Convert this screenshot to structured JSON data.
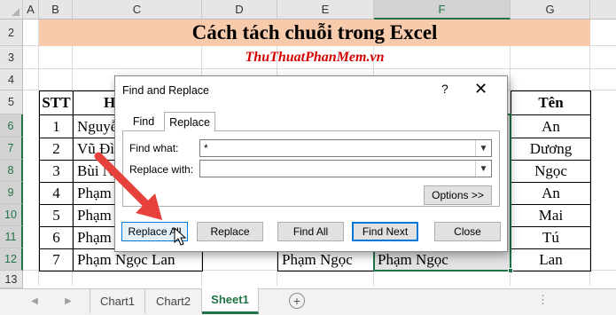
{
  "columns": [
    "A",
    "B",
    "C",
    "D",
    "E",
    "F",
    "G"
  ],
  "selected_column": "F",
  "rows": [
    "1",
    "2",
    "3",
    "4",
    "5",
    "6",
    "7",
    "8",
    "9",
    "10",
    "11",
    "12",
    "13"
  ],
  "sheet": {
    "title": "Cách tách chuỗi trong Excel",
    "subtitle": "ThuThuatPhanMem.vn",
    "table_headers": {
      "stt": "STT",
      "ho_partial": "H",
      "ten": "Tên"
    },
    "stt": [
      "1",
      "2",
      "3",
      "4",
      "5",
      "6",
      "7"
    ],
    "names_partial": [
      "Nguyễ",
      "Vũ Đì",
      "Bùi N",
      "Phạm",
      "Phạm",
      "Phạm",
      "Phạm Ngọc Lan"
    ],
    "ten": [
      "An",
      "Dương",
      "Ngọc",
      "An",
      "Mai",
      "Tú",
      "Lan"
    ],
    "row12_e": "Phạm Ngọc",
    "row12_f": "Phạm Ngọc"
  },
  "tabs": {
    "prev_arrow": "◀",
    "next_arrow": "▶",
    "items": [
      "Chart1",
      "Chart2",
      "Sheet1"
    ],
    "active": "Sheet1",
    "add_symbol": "+",
    "more": "⋮"
  },
  "dialog": {
    "title": "Find and Replace",
    "help": "?",
    "close": "✕",
    "tabs": [
      "Find",
      "Replace"
    ],
    "active_tab": "Replace",
    "find_what_label": "Find what:",
    "find_what_value": "*",
    "replace_with_label": "Replace with:",
    "replace_with_value": "",
    "options_button": "Options >>",
    "buttons": {
      "replace_all": "Replace All",
      "replace": "Replace",
      "find_all": "Find All",
      "find_next": "Find Next",
      "close": "Close"
    }
  },
  "colors": {
    "accent": "#217346",
    "title_fill": "#f7caac",
    "subtitle": "#d40000",
    "arrow": "#e8413c"
  }
}
